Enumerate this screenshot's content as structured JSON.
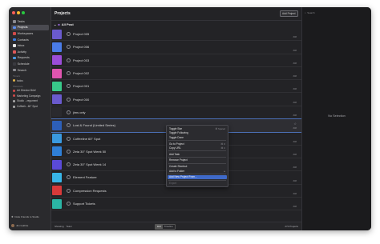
{
  "sidebar": {
    "nav": [
      {
        "label": "Tasks",
        "color": "#8a8a90"
      },
      {
        "label": "Projects",
        "color": "#5b8def",
        "active": true
      },
      {
        "label": "Workspaces",
        "color": "#d24a4a"
      },
      {
        "label": "Contacts",
        "color": "#3c7be0"
      },
      {
        "label": "Inbox",
        "color": "#e6e6e6"
      },
      {
        "label": "Activity",
        "color": "#e05a5a"
      },
      {
        "label": "Requests",
        "color": "#4a9ae0"
      },
      {
        "label": "Schedule",
        "color": "#3a3a40"
      },
      {
        "label": "Search",
        "color": "#8a8a90"
      }
    ],
    "section1": "Timers",
    "timers": [
      {
        "label": "todos",
        "color": "#e0b24a"
      }
    ],
    "section2": "Shortcuts",
    "shortcuts": [
      {
        "label": "Art Director Brief",
        "color": "#d24a4a"
      },
      {
        "label": "Marketing Campaign",
        "color": "#d24a4a"
      },
      {
        "label": "Studio ...regument",
        "color": "#aaaaaa"
      },
      {
        "label": "Coffeeh...60\" Spot",
        "color": "#aaaaaa"
      }
    ],
    "invite": "Invite Friends to Studio",
    "user": "Jim Guthrie"
  },
  "main": {
    "title": "Projects",
    "add_button": "Add Project",
    "group": "All Post",
    "rows": [
      {
        "name": "Project 005",
        "color": "#6a5acd",
        "meta": "###"
      },
      {
        "name": "Project 006",
        "color": "#4a7ce8",
        "meta": "###"
      },
      {
        "name": "Project 003",
        "color": "#9b4dd8",
        "meta": "###"
      },
      {
        "name": "Project 002",
        "color": "#e055b0",
        "meta": "###"
      },
      {
        "name": "Project 001",
        "color": "#38c98a",
        "meta": "###"
      },
      {
        "name": "Project 000",
        "color": "#6a5acd",
        "meta": "###"
      },
      {
        "name": "jims only",
        "color": "#2a2a2e",
        "meta": "###"
      },
      {
        "name": "Lost & Found (Limited Series)",
        "color": "#2d5fb8",
        "meta": "###",
        "selected": true
      },
      {
        "name": "Coffeeline 60\" Spot",
        "color": "#3a9ae0",
        "meta": "###"
      },
      {
        "name": "Zeta 30\" Spot Week 50",
        "color": "#2f7fd6",
        "meta": "###"
      },
      {
        "name": "Zeta 30\" Spot Week 14",
        "color": "#5a4ad8",
        "meta": "###"
      },
      {
        "name": "Element Feature",
        "color": "#38b6e8",
        "meta": "###"
      },
      {
        "name": "Compression Requests",
        "color": "#d83a3a",
        "meta": "###"
      },
      {
        "name": "Support Tickets",
        "color": "#2bb5a5",
        "meta": "###"
      }
    ],
    "status": {
      "showing_label": "Showing",
      "showing_value": "Team",
      "seg_a": "List",
      "seg_b": "Timeline",
      "count": "272 Projects"
    }
  },
  "right": {
    "search_placeholder": "Search",
    "empty": "No Selection"
  },
  "context_menu": {
    "items": [
      {
        "label": "Toggle Star",
        "shortcut": "⌘ Spared"
      },
      {
        "label": "Toggle Following",
        "shortcut": ""
      },
      {
        "label": "Toggle Done",
        "shortcut": ""
      },
      {
        "sep": true
      },
      {
        "label": "Go to Project",
        "shortcut": "⌘ O"
      },
      {
        "label": "Copy URL",
        "shortcut": "⌘ C"
      },
      {
        "sep": true
      },
      {
        "label": "Add Task",
        "shortcut": ""
      },
      {
        "sep": true
      },
      {
        "label": "Remove Project",
        "shortcut": ""
      },
      {
        "sep": true
      },
      {
        "label": "Create Shortcut",
        "shortcut": ""
      },
      {
        "label": "Add to Folder",
        "shortcut": "▸"
      },
      {
        "sep": true
      },
      {
        "label": "Add New Project From...",
        "shortcut": "",
        "highlight": true
      },
      {
        "sep": true
      },
      {
        "label": "Export",
        "shortcut": "",
        "dim": true
      }
    ]
  }
}
